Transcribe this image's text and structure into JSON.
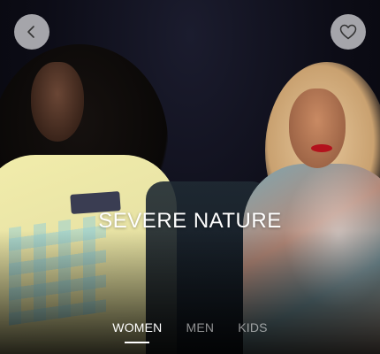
{
  "header": {
    "back_icon": "chevron-left-icon",
    "favorite_icon": "heart-outline-icon"
  },
  "hero": {
    "title": "SEVERE NATURE"
  },
  "tabs": [
    {
      "label": "WOMEN",
      "active": true
    },
    {
      "label": "MEN",
      "active": false
    },
    {
      "label": "KIDS",
      "active": false
    }
  ],
  "colors": {
    "button_bg": "#e1e1e4",
    "text_primary": "#ffffff",
    "text_inactive": "#8c8c90"
  }
}
